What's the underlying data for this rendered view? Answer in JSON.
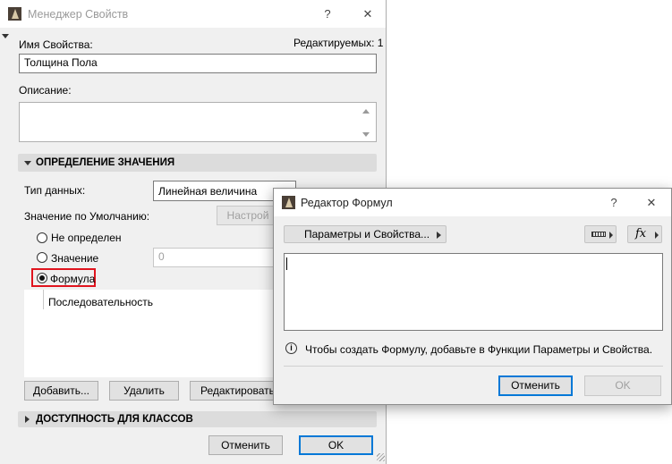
{
  "property_manager": {
    "title": "Менеджер Свойств",
    "help": "?",
    "close": "✕",
    "property_name_label": "Имя Свойства:",
    "editable_count": "Редактируемых: 1",
    "property_name_value": "Толщина Пола",
    "description_label": "Описание:",
    "description_value": "",
    "value_definition_section": "ОПРЕДЕЛЕНИЕ ЗНАЧЕНИЯ",
    "data_type_label": "Тип данных:",
    "data_type_value": "Линейная величина",
    "default_value_label": "Значение по Умолчанию:",
    "setup_button": "Настрой",
    "radio_undefined": "Не определен",
    "radio_value": "Значение",
    "value_field": "0",
    "radio_formula": "Формула",
    "sequence_label": "Последовательность",
    "add_button": "Добавить...",
    "delete_button": "Удалить",
    "edit_button": "Редактировать...",
    "availability_section": "ДОСТУПНОСТЬ ДЛЯ КЛАССОВ",
    "cancel_button": "Отменить",
    "ok_button": "OK"
  },
  "formula_editor": {
    "title": "Редактор Формул",
    "help": "?",
    "close": "✕",
    "params_button": "Параметры и Свойства...",
    "units_icon": "ruler-icon",
    "function_icon": "fx",
    "formula_text": "",
    "info_text": "Чтобы создать Формулу, добавьте в Функции Параметры и Свойства.",
    "cancel_button": "Отменить",
    "ok_button": "OK"
  },
  "colors": {
    "highlight_border": "#e0141e",
    "primary_border": "#0078d7"
  }
}
